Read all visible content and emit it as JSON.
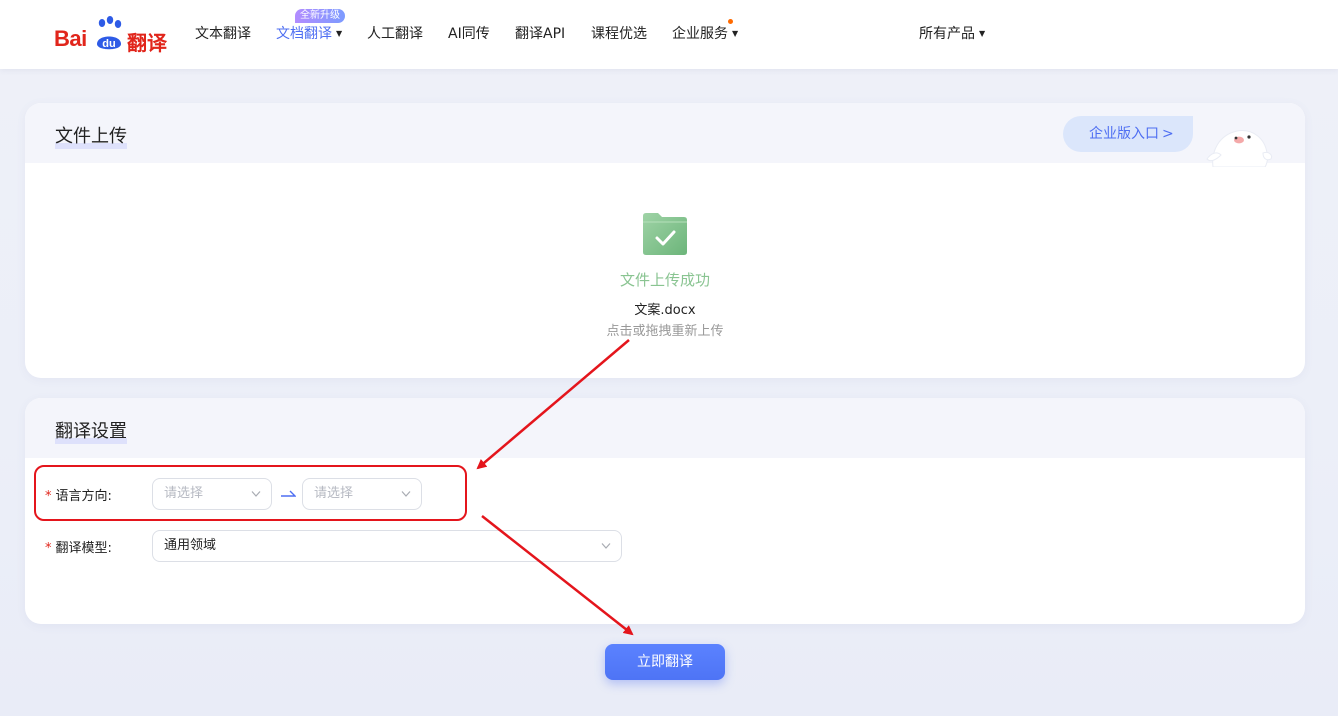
{
  "colors": {
    "brand_red": "#e1251b",
    "accent_blue": "#4e6ef2",
    "success_green": "#89c491",
    "annotation_red": "#e4151c"
  },
  "header": {
    "logo": {
      "bai": "Bai",
      "du": "du",
      "fanyi": "翻译"
    },
    "nav": [
      {
        "label": "文本翻译",
        "active": false
      },
      {
        "label": "文档翻译",
        "active": true,
        "dropdown": true,
        "badge": "全新升级"
      },
      {
        "label": "人工翻译",
        "active": false
      },
      {
        "label": "AI同传",
        "active": false
      },
      {
        "label": "翻译API",
        "active": false
      },
      {
        "label": "课程优选",
        "active": false
      },
      {
        "label": "企业服务",
        "active": false,
        "dropdown": true,
        "notification_dot": true
      }
    ],
    "all_products": "所有产品"
  },
  "upload": {
    "title": "文件上传",
    "enterprise_entry": "企业版入口",
    "status": "文件上传成功",
    "file_name": "文案.docx",
    "reupload_hint": "点击或拖拽重新上传",
    "icons": [
      "folder-check-icon",
      "chevron-right-icon",
      "mascot-icon"
    ]
  },
  "settings": {
    "title": "翻译设置",
    "language_direction": {
      "label": "语言方向:",
      "source_placeholder": "请选择",
      "target_placeholder": "请选择"
    },
    "model": {
      "label": "翻译模型:",
      "value": "通用领域"
    }
  },
  "actions": {
    "translate_button": "立即翻译"
  }
}
